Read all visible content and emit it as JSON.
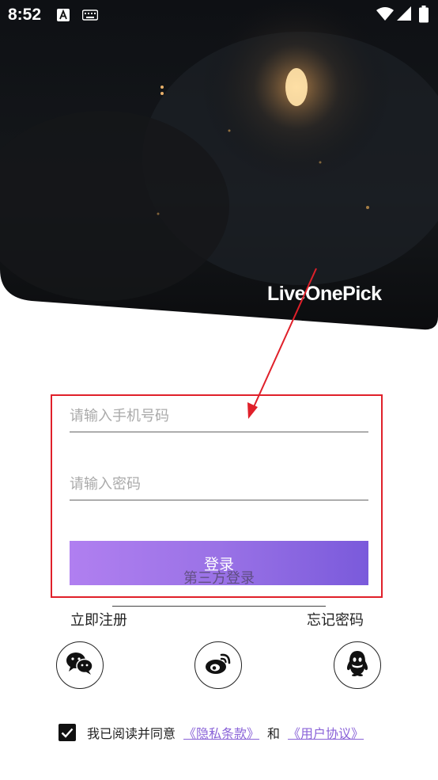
{
  "status_bar": {
    "time": "8:52",
    "icons": [
      "a-notification-icon",
      "keyboard-icon",
      "wifi-icon",
      "signal-icon",
      "battery-icon"
    ]
  },
  "hero": {
    "brand": "LiveOnePick"
  },
  "form": {
    "phone_placeholder": "请输入手机号码",
    "password_placeholder": "请输入密码",
    "login_label": "登录"
  },
  "third_party": {
    "label": "第三方登录"
  },
  "links": {
    "register": "立即注册",
    "forgot_password": "忘记密码"
  },
  "social_icons": [
    "wechat-icon",
    "weibo-icon",
    "qq-icon"
  ],
  "agreement": {
    "checked": true,
    "prefix": "我已阅读并同意",
    "privacy_link": "《隐私条款》",
    "and": "和",
    "terms_link": "《用户协议》"
  },
  "colors": {
    "accent_start": "#b07ff0",
    "accent_end": "#7a5adb",
    "link": "#8a63d8",
    "annotation": "#e0202a"
  }
}
